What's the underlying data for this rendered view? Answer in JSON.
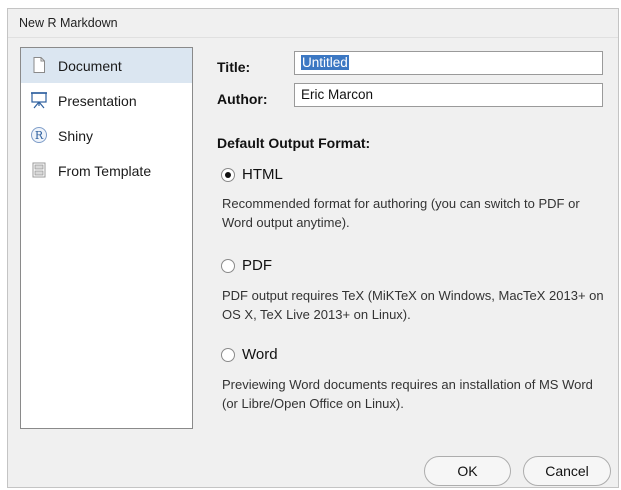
{
  "window": {
    "title": "New R Markdown"
  },
  "sidebar": {
    "items": [
      {
        "label": "Document",
        "icon": "document-icon",
        "selected": true
      },
      {
        "label": "Presentation",
        "icon": "presentation-icon",
        "selected": false
      },
      {
        "label": "Shiny",
        "icon": "shiny-r-icon",
        "selected": false
      },
      {
        "label": "From Template",
        "icon": "template-icon",
        "selected": false
      }
    ]
  },
  "form": {
    "title_label": "Title:",
    "title_value": "Untitled",
    "author_label": "Author:",
    "author_value": "Eric Marcon"
  },
  "output": {
    "section_title": "Default Output Format:",
    "options": [
      {
        "label": "HTML",
        "checked": true,
        "description": "Recommended format for authoring (you can switch to PDF or Word output anytime)."
      },
      {
        "label": "PDF",
        "checked": false,
        "description": "PDF output requires TeX (MiKTeX on Windows, MacTeX 2013+ on OS X, TeX Live 2013+ on Linux)."
      },
      {
        "label": "Word",
        "checked": false,
        "description": "Previewing Word documents requires an installation of MS Word (or Libre/Open Office on Linux)."
      }
    ]
  },
  "buttons": {
    "ok": "OK",
    "cancel": "Cancel"
  },
  "colors": {
    "selection_bg": "#dbe6f1",
    "text_selection": "#3c78c3",
    "dialog_bg": "#f0f0f0"
  }
}
